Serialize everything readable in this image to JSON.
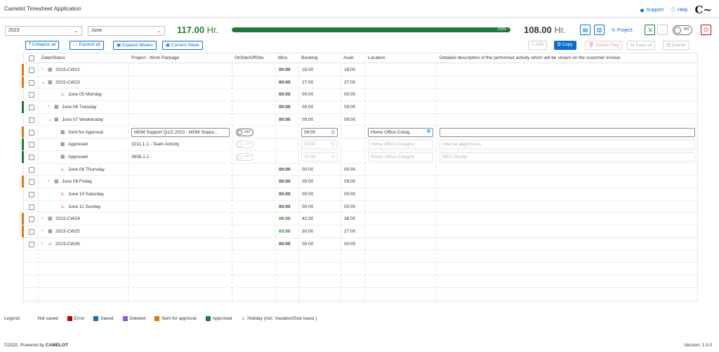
{
  "app": {
    "title": "Camelot Timesheet Application"
  },
  "top_nav": {
    "support": "Support",
    "help": "Help",
    "logo": "C~"
  },
  "filters": {
    "year": "2023",
    "month": "June",
    "total_hours_value": "117.00",
    "total_hours_unit": "Hr.",
    "progress_percent": 100,
    "progress_label": "100%",
    "target_hours_value": "108.00",
    "target_hours_unit": "Hr.",
    "project_label": "Project",
    "toggle_on_label": "ON"
  },
  "buttons": {
    "collapse_all": "Collapse all",
    "expand_all": "Expand all",
    "expand_weeks": "Expand Weeks",
    "current_week": "Current Week",
    "add": "Add",
    "copy": "Copy",
    "delete_flag": "Delete Flag",
    "save_all": "Save all",
    "submit": "Submit"
  },
  "columns": {
    "date_status": "Date/Status",
    "project": "Project - Work Package",
    "onsite": "OnSite/OffSite",
    "miss": "Miss.",
    "booking": "Booking",
    "avail": "Avail.",
    "location": "Location",
    "description": "Detailed description of the performed activity which will be shown on the customer invoice"
  },
  "rows": [
    {
      "label": "2023-CW22",
      "indent": 1,
      "expander": "right",
      "icon": "calendar-icon",
      "miss": "00:00",
      "booking": "18:00",
      "avail": "18:00",
      "status_color": "#e9730c"
    },
    {
      "label": "2023-CW23",
      "indent": 1,
      "expander": "down",
      "icon": "calendar-icon",
      "miss": "00:00",
      "booking": "27:00",
      "avail": "27:00",
      "status_color": "#e9730c"
    },
    {
      "label": "June 05 Monday",
      "indent": 3,
      "expander": "",
      "icon": "holiday-icon",
      "miss": "00:00",
      "booking": "00:00",
      "avail": "00:00",
      "status_color": ""
    },
    {
      "label": "June 06 Tuesday",
      "indent": 2,
      "expander": "right",
      "icon": "calendar-icon",
      "miss": "00:00",
      "booking": "09:00",
      "avail": "09:00",
      "status_color": "#1e7a3c"
    },
    {
      "label": "June 07 Wednesday",
      "indent": 2,
      "expander": "down",
      "icon": "calendar-icon",
      "miss": "00:00",
      "booking": "09:00",
      "avail": "09:00",
      "status_color": ""
    },
    {
      "label": "Sent for Approval",
      "indent": 3,
      "expander": "",
      "icon": "calendar-icon",
      "project": "MDM Support Q1/2 2023 - MDM Suppo...",
      "onsite": "OFF",
      "booking_input": "06:00",
      "location": "Home Office Colog...",
      "description": "",
      "editable": true,
      "status_color": "#e9730c"
    },
    {
      "label": "Approved",
      "indent": 3,
      "expander": "",
      "icon": "calendar-icon",
      "project": "3211.1.1 - Team Activity",
      "onsite": "OFF",
      "booking_input": "02:00",
      "location": "Home Office Cologne",
      "description": "Internal alignments",
      "editable": false,
      "status_color": "#1e7a3c"
    },
    {
      "label": "Approved",
      "indent": 3,
      "expander": "",
      "icon": "calendar-icon",
      "project": "3836.1.2 -",
      "onsite": "OFF",
      "booking_input": "01:00",
      "location": "Home Office Cologne",
      "description": "MED Design",
      "editable": false,
      "status_color": "#1e7a3c"
    },
    {
      "label": "June 08 Thursday",
      "indent": 3,
      "expander": "",
      "icon": "holiday-icon",
      "miss": "00:00",
      "booking": "00:00",
      "avail": "00:00",
      "status_color": ""
    },
    {
      "label": "June 09 Friday",
      "indent": 2,
      "expander": "right",
      "icon": "calendar-icon",
      "miss": "00:00",
      "booking": "09:00",
      "avail": "09:00",
      "status_color": "#e9730c"
    },
    {
      "label": "June 10 Saturday",
      "indent": 3,
      "expander": "",
      "icon": "holiday-icon",
      "miss": "00:00",
      "booking": "00:00",
      "avail": "00:00",
      "status_color": ""
    },
    {
      "label": "June 11 Sunday",
      "indent": 3,
      "expander": "",
      "icon": "holiday-icon",
      "miss": "00:00",
      "booking": "00:00",
      "avail": "00:00",
      "status_color": ""
    },
    {
      "label": "2023-CW24",
      "indent": 1,
      "expander": "right",
      "icon": "calendar-icon",
      "miss": "06:00",
      "miss_green": true,
      "booking": "42:00",
      "avail": "36:00",
      "status_color": "#e9730c"
    },
    {
      "label": "2023-CW25",
      "indent": 1,
      "expander": "right",
      "icon": "calendar-icon",
      "miss": "03:00",
      "miss_green": true,
      "booking": "30:00",
      "avail": "27:00",
      "status_color": "#e9730c"
    },
    {
      "label": "2023-CW26",
      "indent": 1,
      "expander": "right",
      "icon": "holiday-icon",
      "miss": "00:00",
      "booking": "00:00",
      "avail": "00:00",
      "status_color": ""
    }
  ],
  "legend": {
    "title": "Legend:",
    "items": [
      {
        "label": "Not saved",
        "color": "#ffffff"
      },
      {
        "label": "Error",
        "color": "#bb0000"
      },
      {
        "label": "Saved",
        "color": "#0a6ed1"
      },
      {
        "label": "Deleted",
        "color": "#925ace"
      },
      {
        "label": "Sent for approval",
        "color": "#e9730c"
      },
      {
        "label": "Approved",
        "color": "#1e7a3c"
      }
    ],
    "holiday_label": "Holiday (incl. Vacation/Sick leave )"
  },
  "footer": {
    "copyright": "©2022. Powered by",
    "brand": "CAMELOT",
    "version": "Version: 1.3.0"
  }
}
